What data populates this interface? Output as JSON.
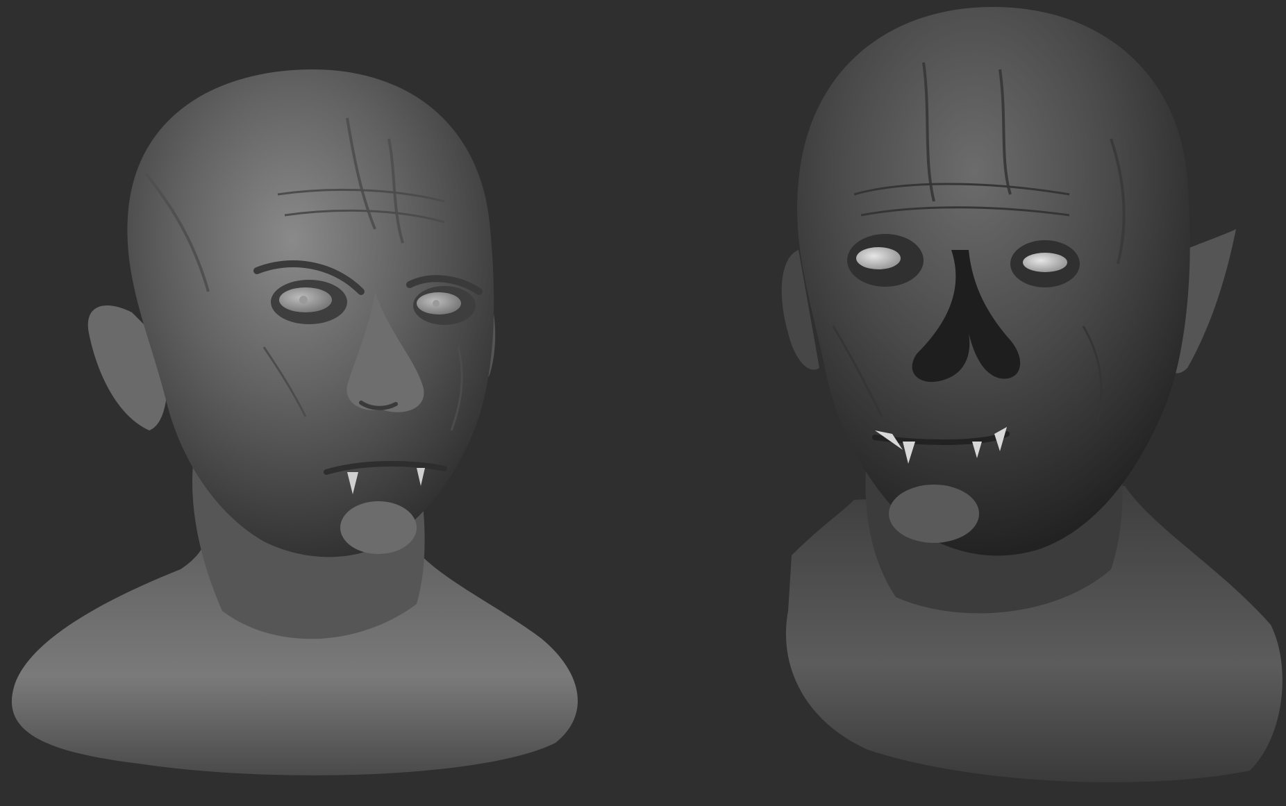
{
  "scene": {
    "background_color": "#2f2f30",
    "material_color": "#6f6f6f",
    "tooth_color": "#d8d8d8",
    "sculpts": [
      {
        "id": "left",
        "description_name": "vampire-bust-human-face",
        "eye_style": "pupils",
        "nose": "intact"
      },
      {
        "id": "right",
        "description_name": "vampire-bust-skull-nose",
        "eye_style": "blank-glowing",
        "nose": "cavity"
      }
    ]
  }
}
